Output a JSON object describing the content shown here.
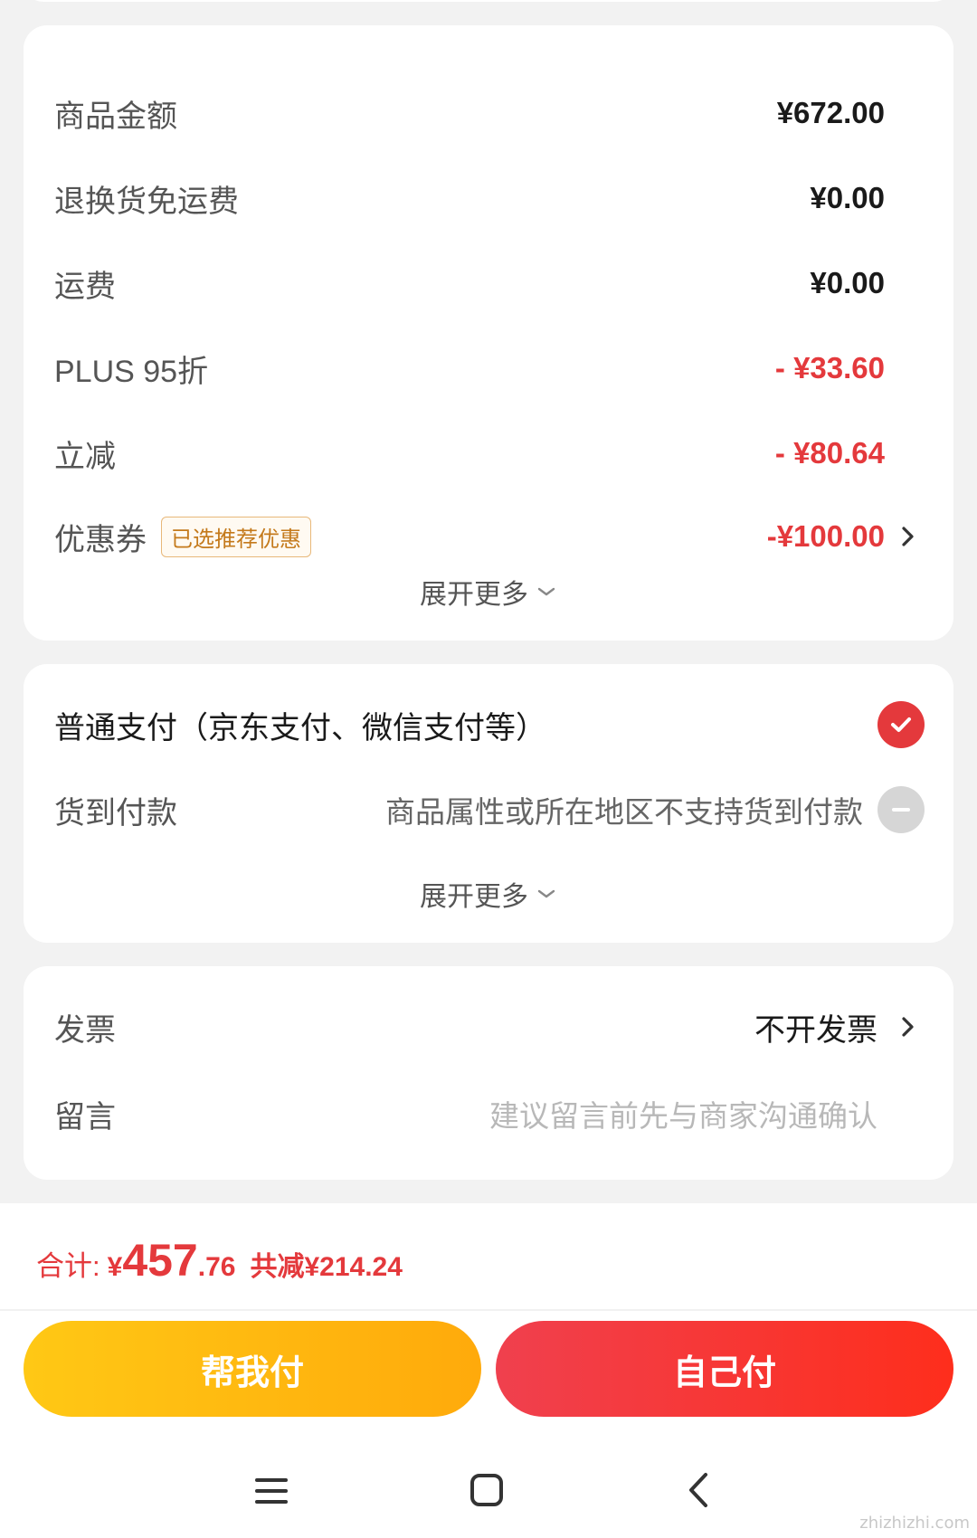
{
  "summary": {
    "rows": [
      {
        "label": "商品金额",
        "value": "¥672.00"
      },
      {
        "label": "退换货免运费",
        "value": "¥0.00"
      },
      {
        "label": "运费",
        "value": "¥0.00"
      },
      {
        "label": "PLUS 95折",
        "value": "- ¥33.60"
      },
      {
        "label": "立减",
        "value": "- ¥80.64"
      }
    ],
    "coupon": {
      "label": "优惠券",
      "badge": "已选推荐优惠",
      "value": "-¥100.00"
    },
    "expand_label": "展开更多"
  },
  "payment": {
    "normal_title": "普通支付（京东支付、微信支付等）",
    "cod_label": "货到付款",
    "cod_hint": "商品属性或所在地区不支持货到付款",
    "expand_label": "展开更多"
  },
  "extra": {
    "invoice_label": "发票",
    "invoice_value": "不开发票",
    "message_label": "留言",
    "message_placeholder": "建议留言前先与商家沟通确认"
  },
  "footer": {
    "total_label": "合计:",
    "currency": "¥",
    "total_int": "457",
    "total_dec": ".76",
    "saved_label": "共减",
    "saved_value": "¥214.24",
    "help_pay": "帮我付",
    "self_pay": "自己付"
  },
  "watermark": "zhizhizhi.com",
  "colors": {
    "accent_red": "#e4393c",
    "help_button": "#ffb30f",
    "self_button": "#f53232"
  },
  "icons": [
    "chevron-right-icon",
    "chevron-down-icon",
    "checkmark-icon",
    "minus-icon",
    "menu-icon",
    "home-icon",
    "back-icon"
  ]
}
